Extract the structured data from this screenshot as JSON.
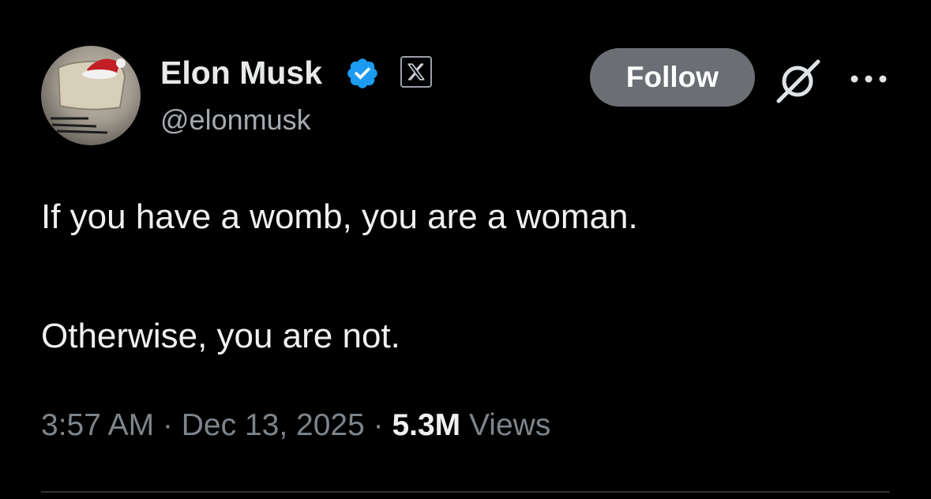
{
  "author": {
    "display_name": "Elon Musk",
    "handle": "@elonmusk",
    "verified": true,
    "verified_color": "#1d9bf0",
    "affiliate_badge": "x-logo",
    "avatar_caption": "THE HISTORY OF THE WORLD"
  },
  "actions": {
    "follow_label": "Follow",
    "grok_icon": "grok-icon",
    "more_icon": "more-icon"
  },
  "tweet": {
    "line1": "If you have a womb, you are a woman.",
    "line2": "Otherwise, you are not."
  },
  "meta": {
    "time": "3:57 AM",
    "sep1": " · ",
    "date": "Dec 13, 2025",
    "sep2": " · ",
    "views_count": "5.3M",
    "views_label": " Views"
  },
  "colors": {
    "background": "#000000",
    "follow_button_bg": "#6b6e72",
    "muted_text": "#7e848a"
  }
}
